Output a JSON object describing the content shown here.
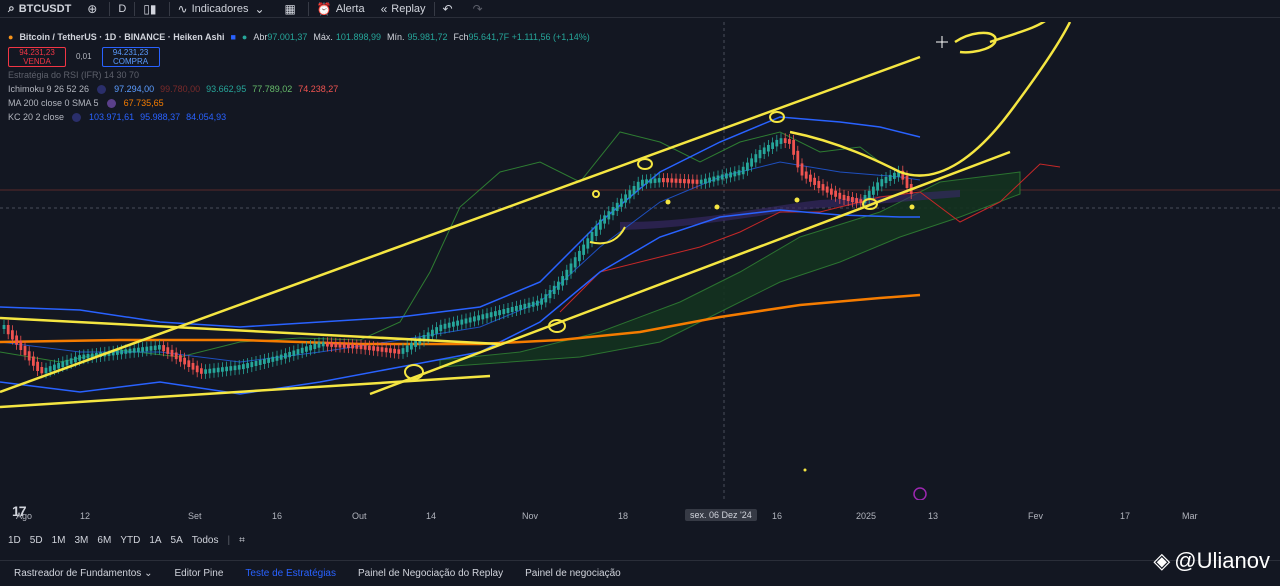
{
  "toolbar": {
    "symbol": "BTCUSDT",
    "interval": "D",
    "indicators_label": "Indicadores",
    "alert_label": "Alerta",
    "replay_label": "Replay"
  },
  "legend": {
    "title": "Bitcoin / TetherUS · 1D · BINANCE · Heiken Ashi",
    "ohlc": {
      "open_k": "Abr",
      "open_v": "97.001,37",
      "high_k": "Máx.",
      "high_v": "101.898,99",
      "low_k": "Mín.",
      "low_v": "95.981,72",
      "close_k": "Fch",
      "close_v": "95.641,7F +1.111,56 (+1,14%)"
    },
    "sell_price": "94.231,23",
    "sell_label": "VENDA",
    "spread": "0,01",
    "buy_price": "94.231,23",
    "buy_label": "COMPRA",
    "strategy": "Estratégia do RSI (IFR) 14 30 70",
    "ichimoku_name": "Ichimoku 9 26 52 26",
    "ichimoku_v1": "97.294,00",
    "ichimoku_v2": "99.780,00",
    "ichimoku_v3": "93.662,95",
    "ichimoku_v4": "77.789,02",
    "ichimoku_v5": "74.238,27",
    "ma_name": "MA 200 close 0 SMA 5",
    "ma_v": "67.735,65",
    "kc_name": "KC 20 2 close",
    "kc_v1": "103.971,61",
    "kc_v2": "95.988,37",
    "kc_v3": "84.054,93"
  },
  "time_axis": {
    "ticks": [
      "Ago",
      "12",
      "Set",
      "16",
      "Out",
      "14",
      "Nov",
      "18",
      "16",
      "2025",
      "13",
      "Fev",
      "17",
      "Mar"
    ],
    "crosshair": "sex. 06 Dez '24"
  },
  "ranges": [
    "1D",
    "5D",
    "1M",
    "3M",
    "6M",
    "YTD",
    "1A",
    "5A",
    "Todos"
  ],
  "bottom_tabs": {
    "t1": "Rastreador de Fundamentos",
    "t2": "Editor Pine",
    "t3": "Teste de Estratégias",
    "t4": "Painel de Negociação do Replay",
    "t5": "Painel de negociação"
  },
  "logo_text": "17",
  "watermark": "@Ulianov",
  "colors": {
    "up": "#26a69a",
    "down": "#ef5350",
    "drawing": "#f5e642",
    "ma": "#f57c00",
    "kc": "#2962ff",
    "cloud_green": "#1b5e20",
    "cloud_red": "#b71c1c"
  }
}
